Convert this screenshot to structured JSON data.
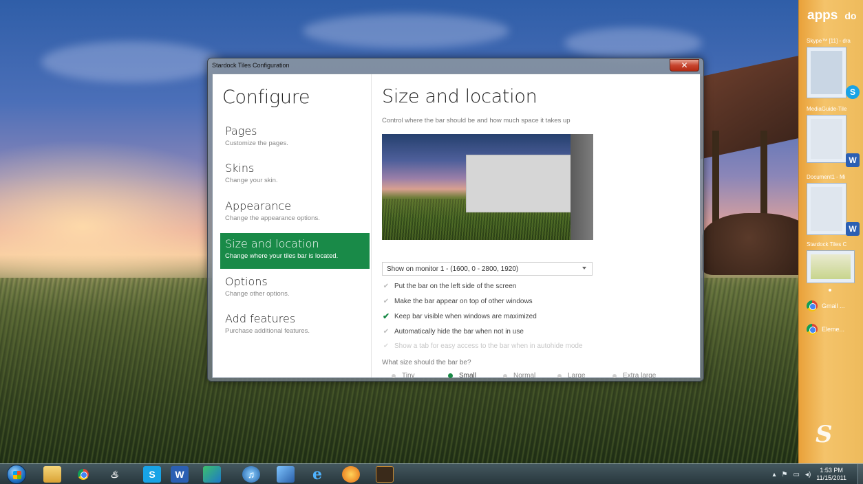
{
  "window": {
    "title": "Stardock Tiles Configuration",
    "close_label": "✕"
  },
  "sidebar": {
    "heading": "Configure",
    "items": [
      {
        "title": "Pages",
        "desc": "Customize the pages."
      },
      {
        "title": "Skins",
        "desc": "Change your skin."
      },
      {
        "title": "Appearance",
        "desc": "Change the appearance options."
      },
      {
        "title": "Size and location",
        "desc": "Change where your tiles bar is located."
      },
      {
        "title": "Options",
        "desc": "Change other options."
      },
      {
        "title": "Add features",
        "desc": "Purchase additional features."
      }
    ],
    "active_index": 3,
    "accent_color": "#198a48"
  },
  "main": {
    "title": "Size and location",
    "subtitle": "Control where the bar should be and how much space it takes up",
    "monitor_select": "Show on monitor 1 - (1600, 0 - 2800, 1920)",
    "options": [
      {
        "label": "Put the bar on the left side of the screen",
        "checked": false,
        "disabled": false
      },
      {
        "label": "Make the bar appear on top of other windows",
        "checked": false,
        "disabled": false
      },
      {
        "label": "Keep bar visible when windows are maximized",
        "checked": true,
        "disabled": false
      },
      {
        "label": "Automatically hide the bar when not in use",
        "checked": false,
        "disabled": false
      },
      {
        "label": "Show a tab for easy access to the bar when in autohide mode",
        "checked": false,
        "disabled": true
      }
    ],
    "size_question": "What size should the bar be?",
    "sizes": [
      "Tiny",
      "Small",
      "Normal",
      "Large",
      "Extra large"
    ],
    "selected_size": "Small"
  },
  "tiles_bar": {
    "tabs": [
      "apps",
      "do"
    ],
    "tiles": [
      {
        "label": "Skype™ [11] - dra",
        "icon": "skype-icon",
        "badge": "S"
      },
      {
        "label": "MediaGuide-Tile",
        "icon": "word-icon",
        "badge": "W"
      },
      {
        "label": "Document1 - Mi",
        "icon": "word-icon",
        "badge": "W"
      },
      {
        "label": "Stardock Tiles C",
        "icon": "stardock-tiles-icon",
        "badge": ""
      }
    ],
    "chrome_items": [
      "Gmail ...",
      "Eleme..."
    ],
    "colors": {
      "background": "#f0b24c",
      "skype": "#18a3e6",
      "word": "#2b5fb3"
    }
  },
  "taskbar": {
    "icons": [
      "windows-explorer-icon",
      "chrome-icon",
      "java-icon",
      "skype-icon",
      "word-icon",
      "paint-icon",
      "itunes-icon",
      "virtualbox-icon",
      "internet-explorer-icon",
      "settings-icon",
      "app-icon"
    ],
    "time": "1:53 PM",
    "date": "11/15/2011"
  }
}
